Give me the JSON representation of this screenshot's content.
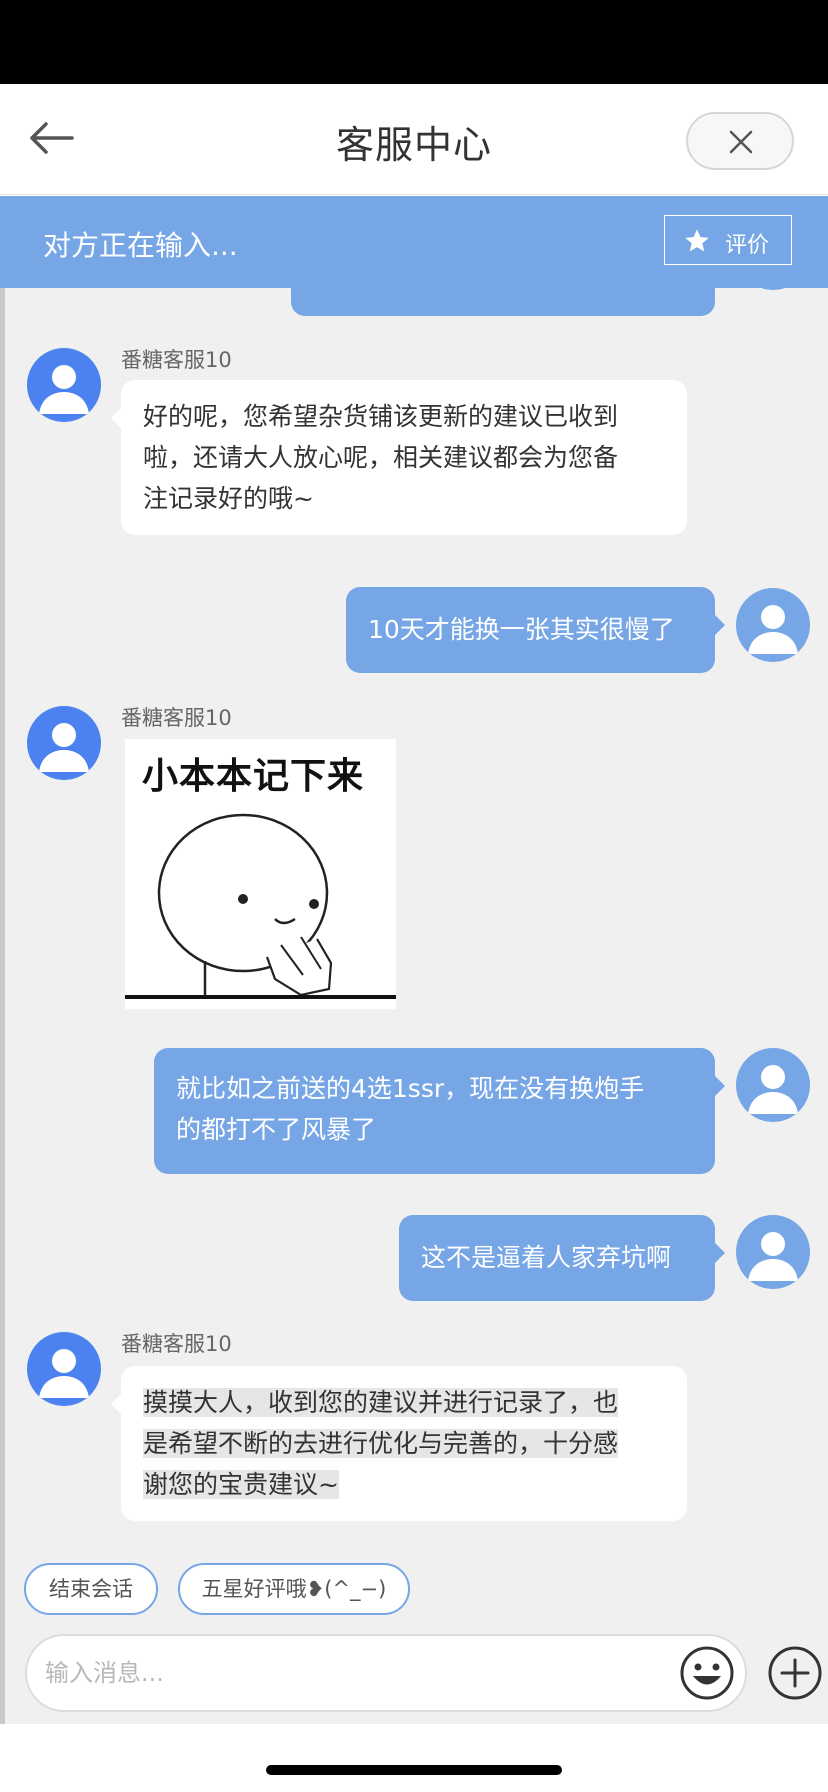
{
  "header": {
    "title": "客服中心"
  },
  "banner": {
    "status_text": "对方正在输入...",
    "rate_label": "评价"
  },
  "messages": [
    {
      "from": "agent",
      "name": "番糖客服10",
      "lines": [
        "好的呢，您希望杂货铺该更新的建议已收到",
        "啦，还请大人放心呢，相关建议都会为您备",
        "注记录好的哦~"
      ]
    },
    {
      "from": "user",
      "lines": [
        "10天才能换一张其实很慢了"
      ]
    },
    {
      "from": "agent",
      "name": "番糖客服10",
      "sticker_text": "小本本记下来"
    },
    {
      "from": "user",
      "lines": [
        "就比如之前送的4选1ssr，现在没有换炮手",
        "的都打不了风暴了"
      ]
    },
    {
      "from": "user",
      "lines": [
        "这不是逼着人家弃坑啊"
      ]
    },
    {
      "from": "agent",
      "name": "番糖客服10",
      "lines": [
        "摸摸大人，收到您的建议并进行记录了，也",
        "是希望不断的去进行优化与完善的，十分感",
        "谢您的宝贵建议~"
      ]
    }
  ],
  "quick_replies": [
    "结束会话",
    "五星好评哦❥(^_−)"
  ],
  "composer": {
    "placeholder": "输入消息..."
  },
  "icons": {
    "back": "back-arrow-icon",
    "close": "close-icon",
    "star": "star-icon",
    "emoji": "smiley-icon",
    "plus": "plus-icon",
    "avatar": "person-icon"
  },
  "colors": {
    "accent": "#76a6e5",
    "agent_avatar": "#4b82ef",
    "chat_bg": "#f0f0f0"
  }
}
